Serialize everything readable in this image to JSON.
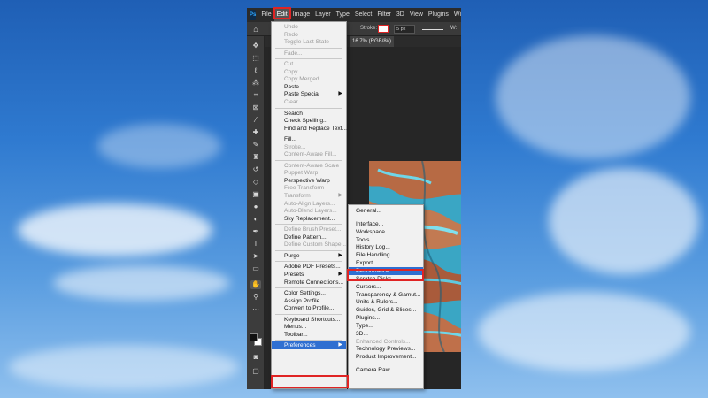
{
  "menubar": {
    "app_icon": "Ps",
    "items": [
      "File",
      "Edit",
      "Image",
      "Layer",
      "Type",
      "Select",
      "Filter",
      "3D",
      "View",
      "Plugins",
      "Window"
    ],
    "active": "Edit"
  },
  "options_bar": {
    "stroke_label": "Stroke:",
    "stroke_width": "5 px",
    "trailing": "W:"
  },
  "document_tab": {
    "label": "16.7% (RGB/8#)"
  },
  "edit_menu": {
    "items": [
      {
        "label": "Undo",
        "disabled": true
      },
      {
        "label": "Redo",
        "disabled": true
      },
      {
        "label": "Toggle Last State",
        "disabled": true
      },
      {
        "separator": true
      },
      {
        "label": "Fade...",
        "disabled": true
      },
      {
        "separator": true
      },
      {
        "label": "Cut",
        "disabled": true
      },
      {
        "label": "Copy",
        "disabled": true
      },
      {
        "label": "Copy Merged",
        "disabled": true
      },
      {
        "label": "Paste",
        "disabled": false
      },
      {
        "label": "Paste Special",
        "disabled": false,
        "submenu": true
      },
      {
        "label": "Clear",
        "disabled": true
      },
      {
        "separator": true
      },
      {
        "label": "Search",
        "disabled": false
      },
      {
        "label": "Check Spelling...",
        "disabled": false
      },
      {
        "label": "Find and Replace Text...",
        "disabled": false
      },
      {
        "separator": true
      },
      {
        "label": "Fill...",
        "disabled": false
      },
      {
        "label": "Stroke...",
        "disabled": true
      },
      {
        "label": "Content-Aware Fill...",
        "disabled": true
      },
      {
        "separator": true
      },
      {
        "label": "Content-Aware Scale",
        "disabled": true
      },
      {
        "label": "Puppet Warp",
        "disabled": true
      },
      {
        "label": "Perspective Warp",
        "disabled": false
      },
      {
        "label": "Free Transform",
        "disabled": true
      },
      {
        "label": "Transform",
        "disabled": true,
        "submenu": true
      },
      {
        "label": "Auto-Align Layers...",
        "disabled": true
      },
      {
        "label": "Auto-Blend Layers...",
        "disabled": true
      },
      {
        "label": "Sky Replacement...",
        "disabled": false
      },
      {
        "separator": true
      },
      {
        "label": "Define Brush Preset...",
        "disabled": true
      },
      {
        "label": "Define Pattern...",
        "disabled": false
      },
      {
        "label": "Define Custom Shape...",
        "disabled": true
      },
      {
        "separator": true
      },
      {
        "label": "Purge",
        "disabled": false,
        "submenu": true
      },
      {
        "separator": true
      },
      {
        "label": "Adobe PDF Presets...",
        "disabled": false
      },
      {
        "label": "Presets",
        "disabled": false,
        "submenu": true
      },
      {
        "label": "Remote Connections...",
        "disabled": false
      },
      {
        "separator": true
      },
      {
        "label": "Color Settings...",
        "disabled": false
      },
      {
        "label": "Assign Profile...",
        "disabled": false
      },
      {
        "label": "Convert to Profile...",
        "disabled": false
      },
      {
        "separator": true
      },
      {
        "label": "Keyboard Shortcuts...",
        "disabled": false
      },
      {
        "label": "Menus...",
        "disabled": false
      },
      {
        "label": "Toolbar...",
        "disabled": false
      },
      {
        "separator": true
      },
      {
        "label": "Preferences",
        "disabled": false,
        "submenu": true,
        "highlighted": true
      }
    ]
  },
  "preferences_menu": {
    "items": [
      {
        "label": "General..."
      },
      {
        "separator": true
      },
      {
        "label": "Interface..."
      },
      {
        "label": "Workspace..."
      },
      {
        "label": "Tools..."
      },
      {
        "label": "History Log..."
      },
      {
        "label": "File Handling..."
      },
      {
        "label": "Export..."
      },
      {
        "label": "Performance...",
        "highlighted": true
      },
      {
        "label": "Scratch Disks..."
      },
      {
        "label": "Cursors..."
      },
      {
        "label": "Transparency & Gamut..."
      },
      {
        "label": "Units & Rulers..."
      },
      {
        "label": "Guides, Grid & Slices..."
      },
      {
        "label": "Plugins..."
      },
      {
        "label": "Type..."
      },
      {
        "label": "3D..."
      },
      {
        "label": "Enhanced Controls...",
        "disabled": true
      },
      {
        "label": "Technology Previews..."
      },
      {
        "label": "Product Improvement..."
      },
      {
        "separator": true
      },
      {
        "label": "Camera Raw..."
      }
    ]
  },
  "tools": [
    "move-icon",
    "marquee-icon",
    "lasso-icon",
    "magic-wand-icon",
    "crop-icon",
    "frame-icon",
    "eyedropper-icon",
    "healing-brush-icon",
    "brush-icon",
    "clone-stamp-icon",
    "history-brush-icon",
    "eraser-icon",
    "gradient-icon",
    "blur-icon",
    "dodge-icon",
    "pen-icon",
    "type-icon",
    "path-selection-icon",
    "rectangle-icon",
    "hand-icon",
    "zoom-icon",
    "more-tools-icon",
    "quick-mask-icon",
    "screen-mode-icon"
  ],
  "colors": {
    "highlight": "#2f6fd1",
    "annotation": "#e02424",
    "menu_bg": "#f1f1f1",
    "ps_dark": "#323232"
  }
}
